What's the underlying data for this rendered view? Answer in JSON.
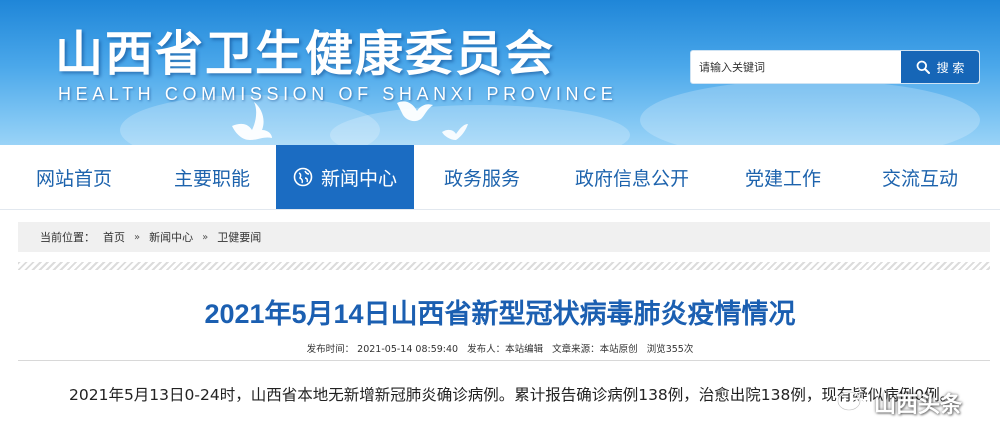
{
  "header": {
    "title": "山西省卫生健康委员会",
    "subtitle": "HEALTH COMMISSION OF SHANXI PROVINCE",
    "search": {
      "placeholder": "请输入关键词",
      "button_label": "搜 索"
    }
  },
  "nav": {
    "items": [
      {
        "label": "网站首页"
      },
      {
        "label": "主要职能"
      },
      {
        "label": "新闻中心",
        "active": true
      },
      {
        "label": "政务服务"
      },
      {
        "label": "政府信息公开"
      },
      {
        "label": "党建工作"
      },
      {
        "label": "交流互动"
      }
    ]
  },
  "breadcrumb": {
    "prefix": "当前位置：",
    "items": [
      {
        "label": "首页"
      },
      {
        "label": "新闻中心"
      },
      {
        "label": "卫健要闻"
      }
    ],
    "separator": "»"
  },
  "article": {
    "title": "2021年5月14日山西省新型冠状病毒肺炎疫情情况",
    "meta": {
      "published": "发布时间：  2021-05-14 08:59:40",
      "author": "发布人：本站编辑",
      "source": "文章来源：本站原创",
      "views": "浏览355次"
    },
    "body": "2021年5月13日0-24时，山西省本地无新增新冠肺炎确诊病例。累计报告确诊病例138例，治愈出院138例，现有疑似病例0例。"
  },
  "watermark": {
    "text": "山西头条"
  },
  "colors": {
    "banner_top": "#1f86d8",
    "nav_text": "#1d63ad",
    "nav_active_bg": "#1b6cc2",
    "search_button": "#1666b7",
    "title_blue": "#1b5fb1"
  },
  "icons": {
    "search": "search-icon",
    "nav_active": "globe-icon",
    "dove": "dove-icon",
    "watermark": "wechat-icon"
  }
}
